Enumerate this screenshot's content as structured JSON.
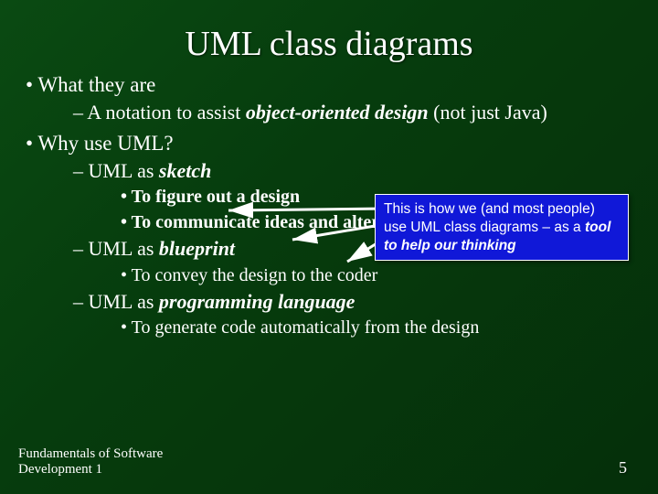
{
  "title": "UML class diagrams",
  "bullets": {
    "what_label": "What they are",
    "what_sub": {
      "pre": "A notation to assist ",
      "em": "object-oriented design",
      "post": " (not just Java)"
    },
    "why_label": "Why use UML?",
    "sketch": {
      "pre": "UML as ",
      "em": "sketch"
    },
    "sketch_sub1": "To figure out a design",
    "sketch_sub2": "To communicate ideas and alternatives",
    "blueprint": {
      "pre": "UML as ",
      "em": "blueprint"
    },
    "blueprint_sub1": "To convey the design to the coder",
    "proglang": {
      "pre": "UML as ",
      "em": "programming language"
    },
    "proglang_sub1": "To generate code automatically from the design"
  },
  "callout": {
    "line1": "This is how we (and most people) use UML class diagrams – as a ",
    "em": "tool to help our thinking"
  },
  "footer": {
    "line1": "Fundamentals of Software",
    "line2": "Development 1"
  },
  "page_number": "5"
}
